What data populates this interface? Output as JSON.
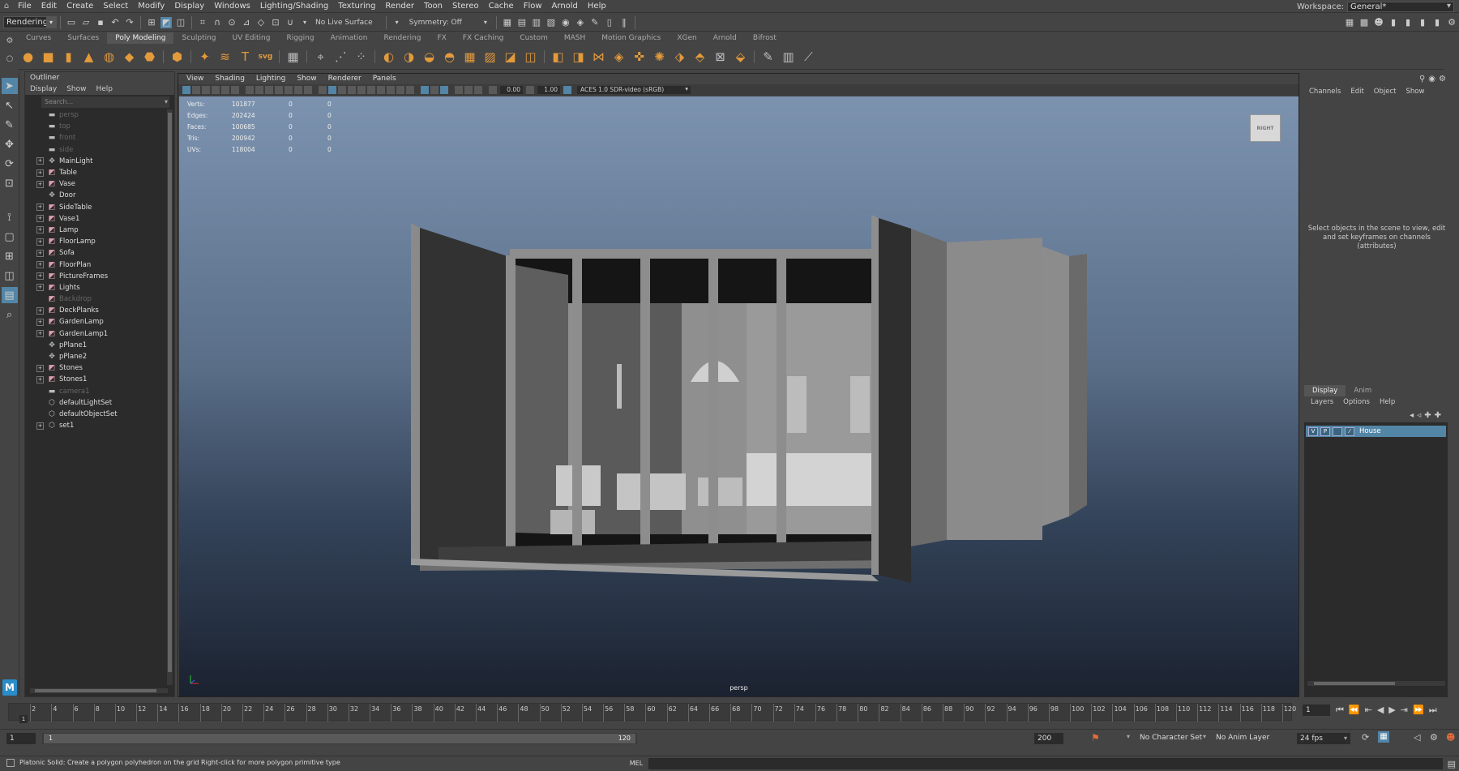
{
  "menubar": {
    "items": [
      "File",
      "Edit",
      "Create",
      "Select",
      "Modify",
      "Display",
      "Windows",
      "Lighting/Shading",
      "Texturing",
      "Render",
      "Toon",
      "Stereo",
      "Cache",
      "Flow",
      "Arnold",
      "Help"
    ],
    "workspace_label": "Workspace:",
    "workspace_value": "General*"
  },
  "statusline": {
    "menuset": "Rendering",
    "live_surface": "No Live Surface",
    "symmetry": "Symmetry: Off"
  },
  "shelf": {
    "tabs": [
      "Curves",
      "Surfaces",
      "Poly Modeling",
      "Sculpting",
      "UV Editing",
      "Rigging",
      "Animation",
      "Rendering",
      "FX",
      "FX Caching",
      "Custom",
      "MASH",
      "Motion Graphics",
      "XGen",
      "Arnold",
      "Bifrost"
    ],
    "active_tab": "Poly Modeling"
  },
  "outliner": {
    "title": "Outliner",
    "menu": [
      "Display",
      "Show",
      "Help"
    ],
    "search_placeholder": "Search...",
    "items": [
      {
        "label": "persp",
        "icon": "camera-icon",
        "expand": false,
        "dim": true
      },
      {
        "label": "top",
        "icon": "camera-icon",
        "expand": false,
        "dim": true
      },
      {
        "label": "front",
        "icon": "camera-icon",
        "expand": false,
        "dim": true
      },
      {
        "label": "side",
        "icon": "camera-icon",
        "expand": false,
        "dim": true
      },
      {
        "label": "MainLight",
        "icon": "transform-icon",
        "expand": true,
        "dim": false
      },
      {
        "label": "Table",
        "icon": "mesh-icon",
        "expand": true,
        "dim": false
      },
      {
        "label": "Vase",
        "icon": "mesh-icon",
        "expand": true,
        "dim": false
      },
      {
        "label": "Door",
        "icon": "transform-icon",
        "expand": false,
        "dim": false
      },
      {
        "label": "SideTable",
        "icon": "mesh-icon",
        "expand": true,
        "dim": false
      },
      {
        "label": "Vase1",
        "icon": "mesh-icon",
        "expand": true,
        "dim": false
      },
      {
        "label": "Lamp",
        "icon": "mesh-icon",
        "expand": true,
        "dim": false
      },
      {
        "label": "FloorLamp",
        "icon": "mesh-icon",
        "expand": true,
        "dim": false
      },
      {
        "label": "Sofa",
        "icon": "mesh-icon",
        "expand": true,
        "dim": false
      },
      {
        "label": "FloorPlan",
        "icon": "mesh-icon",
        "expand": true,
        "dim": false
      },
      {
        "label": "PictureFrames",
        "icon": "mesh-icon",
        "expand": true,
        "dim": false
      },
      {
        "label": "Lights",
        "icon": "mesh-icon",
        "expand": true,
        "dim": false
      },
      {
        "label": "Backdrop",
        "icon": "mesh-icon",
        "expand": false,
        "dim": true
      },
      {
        "label": "DeckPlanks",
        "icon": "mesh-icon",
        "expand": true,
        "dim": false
      },
      {
        "label": "GardenLamp",
        "icon": "mesh-icon",
        "expand": true,
        "dim": false
      },
      {
        "label": "GardenLamp1",
        "icon": "mesh-icon",
        "expand": true,
        "dim": false
      },
      {
        "label": "pPlane1",
        "icon": "transform-icon",
        "expand": false,
        "dim": false
      },
      {
        "label": "pPlane2",
        "icon": "transform-icon",
        "expand": false,
        "dim": false
      },
      {
        "label": "Stones",
        "icon": "mesh-icon",
        "expand": true,
        "dim": false
      },
      {
        "label": "Stones1",
        "icon": "mesh-icon",
        "expand": true,
        "dim": false
      },
      {
        "label": "camera1",
        "icon": "camera-icon",
        "expand": false,
        "dim": true
      },
      {
        "label": "defaultLightSet",
        "icon": "set-icon",
        "expand": false,
        "dim": false
      },
      {
        "label": "defaultObjectSet",
        "icon": "set-icon",
        "expand": false,
        "dim": false
      },
      {
        "label": "set1",
        "icon": "set-icon",
        "expand": true,
        "dim": false
      }
    ]
  },
  "viewport": {
    "menu": [
      "View",
      "Shading",
      "Lighting",
      "Show",
      "Renderer",
      "Panels"
    ],
    "exposure": "0.00",
    "gamma": "1.00",
    "colorspace": "ACES 1.0 SDR-video (sRGB)",
    "camera": "persp",
    "viewcube": "RIGHT",
    "hud": [
      {
        "label": "Verts:",
        "value": "101877",
        "a": "0",
        "b": "0"
      },
      {
        "label": "Edges:",
        "value": "202424",
        "a": "0",
        "b": "0"
      },
      {
        "label": "Faces:",
        "value": "100685",
        "a": "0",
        "b": "0"
      },
      {
        "label": "Tris:",
        "value": "200942",
        "a": "0",
        "b": "0"
      },
      {
        "label": "UVs:",
        "value": "118004",
        "a": "0",
        "b": "0"
      }
    ]
  },
  "channelbox": {
    "menu": [
      "Channels",
      "Edit",
      "Object",
      "Show"
    ],
    "hint": "Select objects in the scene to view, edit and set keyframes on channels (attributes)"
  },
  "layereditor": {
    "tabs": [
      "Display",
      "Anim"
    ],
    "menu": [
      "Layers",
      "Options",
      "Help"
    ],
    "layer": {
      "v": "V",
      "p": "P",
      "name": "House"
    }
  },
  "timeslider": {
    "ticks": [
      "2",
      "4",
      "6",
      "8",
      "10",
      "12",
      "14",
      "16",
      "18",
      "20",
      "22",
      "24",
      "26",
      "28",
      "30",
      "32",
      "34",
      "36",
      "38",
      "40",
      "42",
      "44",
      "46",
      "48",
      "50",
      "52",
      "54",
      "56",
      "58",
      "60",
      "62",
      "64",
      "66",
      "68",
      "70",
      "72",
      "74",
      "76",
      "78",
      "80",
      "82",
      "84",
      "86",
      "88",
      "90",
      "92",
      "94",
      "96",
      "98",
      "100",
      "102",
      "104",
      "106",
      "108",
      "110",
      "112",
      "114",
      "116",
      "118",
      "120"
    ],
    "current_frame": "1",
    "frame_field": "1"
  },
  "rangeslider": {
    "start": "1",
    "range_start": "1",
    "range_end": "120",
    "end": "200",
    "character_set": "No Character Set",
    "anim_layer": "No Anim Layer",
    "fps": "24 fps"
  },
  "helpline": {
    "text": "Platonic Solid: Create a polygon polyhedron on the grid Right-click for more polygon primitive type",
    "mel": "MEL"
  },
  "colors": {
    "accent": "#5285a6",
    "shelf_orange": "#e39a3b",
    "panel_bg": "#444444",
    "field_bg": "#2b2b2b"
  }
}
